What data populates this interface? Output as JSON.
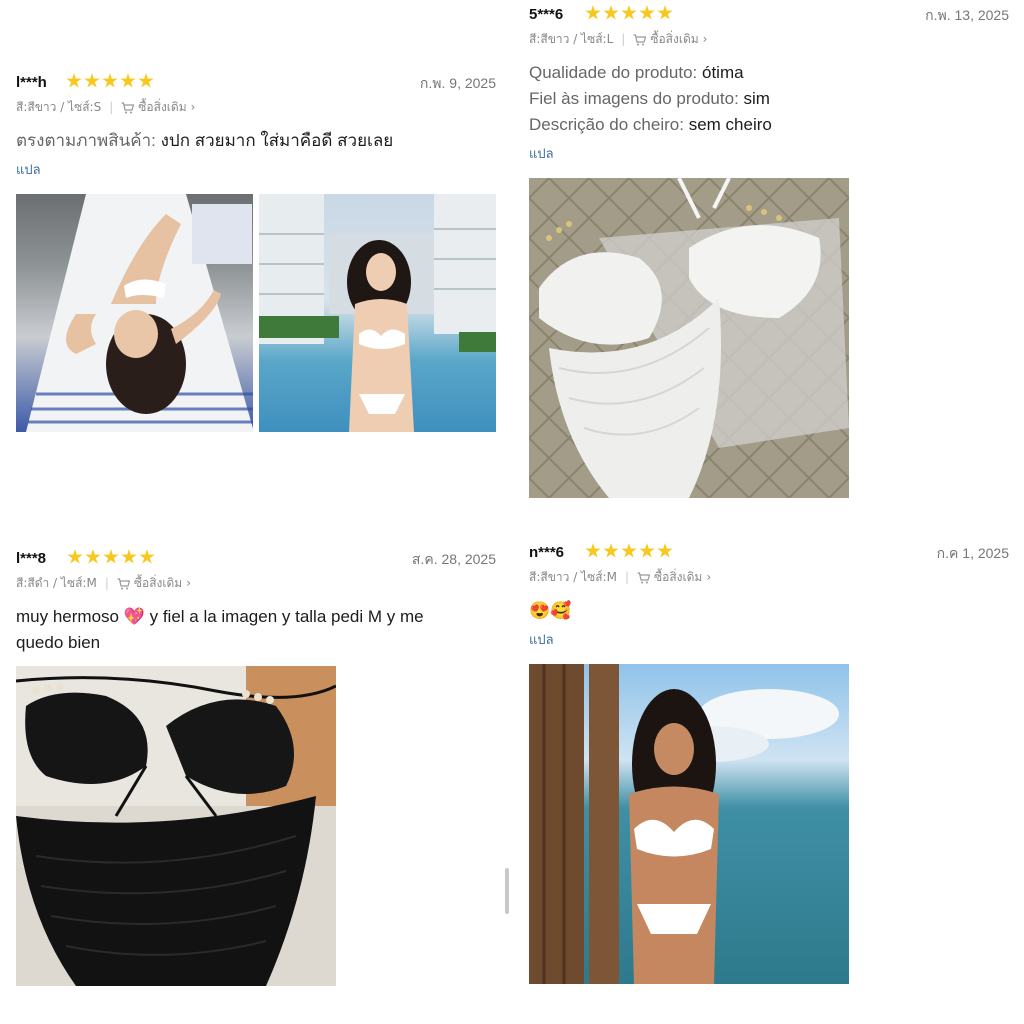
{
  "reviews": [
    {
      "user": "l***h",
      "date": "ก.พ. 9, 2025",
      "color": "สี:สีขาว",
      "size": "ไซส์:S",
      "buy_again": "ซื้อสิ่งเดิม",
      "label": "ตรงตามภาพสินค้า:",
      "value": "งปก สวยมาก ใส่มาคือดี สวยเลย",
      "translate": "แปล",
      "stars": 5
    },
    {
      "user": "5***6",
      "date": "ก.พ. 13, 2025",
      "color": "สี:สีขาว",
      "size": "ไซส์:L",
      "buy_again": "ซื้อสิ่งเดิม",
      "lines": [
        {
          "label": "Qualidade do produto:",
          "value": "ótima"
        },
        {
          "label": "Fiel às imagens do produto:",
          "value": "sim"
        },
        {
          "label": "Descrição do cheiro:",
          "value": "sem cheiro"
        }
      ],
      "translate": "แปล",
      "stars": 5
    },
    {
      "user": "l***8",
      "date": "ส.ค. 28, 2025",
      "color": "สี:สีดำ",
      "size": "ไซส์:M",
      "buy_again": "ซื้อสิ่งเดิม",
      "text1": "muy hermoso 💖 y fiel a la imagen y talla pedi M y me",
      "text2": "quedo bien",
      "stars": 5
    },
    {
      "user": "n***6",
      "date": "ก.ค 1, 2025",
      "color": "สี:สีขาว",
      "size": "ไซส์:M",
      "buy_again": "ซื้อสิ่งเดิม",
      "text": "😍🥰",
      "translate": "แปล",
      "stars": 5
    }
  ],
  "colors": {
    "star": "#f7c81e",
    "link": "#3e6e9e",
    "meta": "#888888"
  },
  "icons": {
    "star": "star-icon",
    "cart": "cart-icon",
    "chevron": "chevron-right-icon"
  }
}
